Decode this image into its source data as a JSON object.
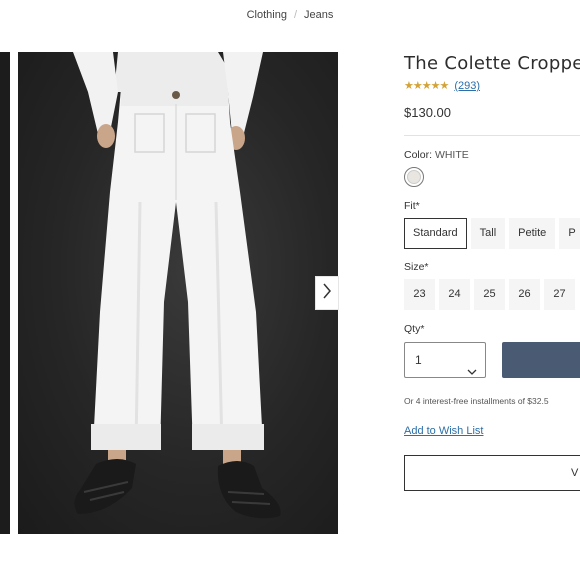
{
  "breadcrumb": {
    "items": [
      "Clothing",
      "Jeans"
    ],
    "separator": "/"
  },
  "gallery": {
    "next_icon": "chevron-right-icon"
  },
  "product": {
    "title": "The Colette Cropped",
    "rating_stars": "★★★★★",
    "review_count": "(293)",
    "price": "$130.00",
    "color_label": "Color:",
    "color_value": "WHITE",
    "fit_label": "Fit*",
    "fit_options": [
      "Standard",
      "Tall",
      "Petite",
      "P"
    ],
    "size_label": "Size*",
    "sizes": [
      "23",
      "24",
      "25",
      "26",
      "27"
    ],
    "qty_label": "Qty*",
    "qty_value": "1",
    "installments": "Or 4 interest-free installments of $32.5",
    "wish_list": "Add to Wish List",
    "outline_button_label": "V",
    "colors": {
      "accent_button": "#4a5a73",
      "link": "#2c6ea8",
      "stars": "#d4a338"
    }
  }
}
